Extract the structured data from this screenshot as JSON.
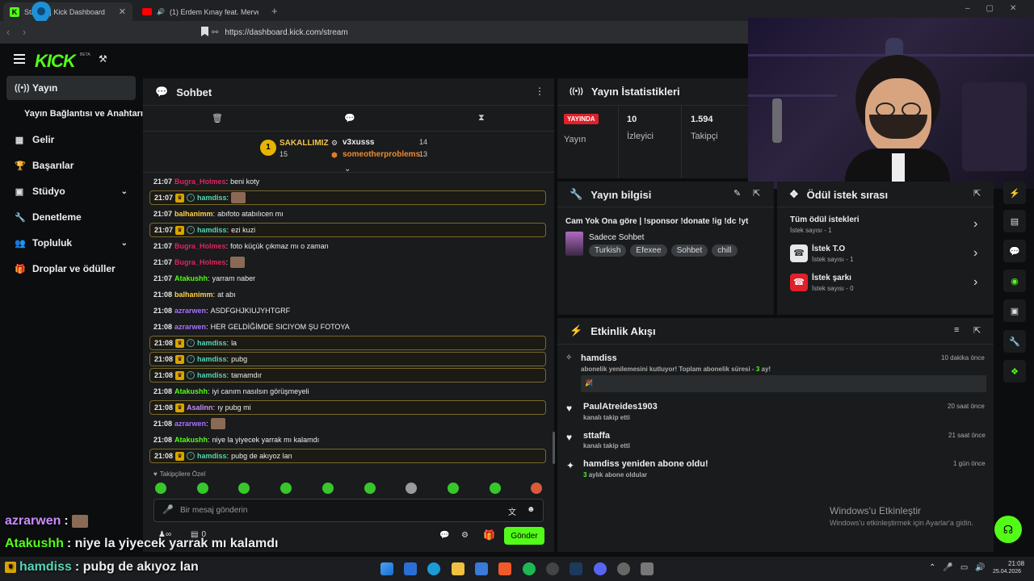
{
  "browser": {
    "tabs": [
      {
        "title": "Stream | Kick Dashboard",
        "active": true
      },
      {
        "title": "(1) Erdem Kınay feat. Merve Özbe...",
        "active": false
      }
    ],
    "url": "https://dashboard.kick.com/stream"
  },
  "app": {
    "logo": "KICK",
    "beta": "BETA"
  },
  "sidebar": {
    "items": [
      {
        "label": "Yayın",
        "icon": "broadcast-icon",
        "active": true
      },
      {
        "label": "Yayın Bağlantısı ve Anahtarı",
        "icon": ""
      },
      {
        "label": "Gelir",
        "icon": "money-icon"
      },
      {
        "label": "Başarılar",
        "icon": "trophy-icon"
      },
      {
        "label": "Stüdyo",
        "icon": "studio-icon",
        "chevron": true
      },
      {
        "label": "Denetleme",
        "icon": "wrench-icon"
      },
      {
        "label": "Topluluk",
        "icon": "community-icon",
        "chevron": true
      },
      {
        "label": "Droplar ve ödüller",
        "icon": "gift-icon"
      }
    ]
  },
  "chat": {
    "title": "Sohbet",
    "leaderboard": {
      "top": {
        "name": "SAKALLIMIZ",
        "count": "15",
        "rank": "1"
      },
      "others": [
        {
          "name": "v3xusss",
          "count": "14"
        },
        {
          "name": "someotherproblems",
          "count": "13"
        }
      ]
    },
    "messages": [
      {
        "time": "21:07",
        "user": "Bugra_Holmes",
        "color": "#e0245e",
        "text": "beni koty",
        "hl": false,
        "badges": false,
        "emote": false
      },
      {
        "time": "21:07",
        "user": "hamdiss",
        "color": "#53d6b7",
        "text": "",
        "hl": true,
        "badges": true,
        "emote": true
      },
      {
        "time": "21:07",
        "user": "balhanimm",
        "color": "#ffd24a",
        "text": "abıfoto atabılıcen mı",
        "hl": false,
        "badges": false,
        "emote": false
      },
      {
        "time": "21:07",
        "user": "hamdiss",
        "color": "#53d6b7",
        "text": "ezi kuzi",
        "hl": true,
        "badges": true,
        "emote": false
      },
      {
        "time": "21:07",
        "user": "Bugra_Holmes",
        "color": "#e0245e",
        "text": "foto küçük çıkmaz mı o zaman",
        "hl": false,
        "badges": false,
        "emote": false
      },
      {
        "time": "21:07",
        "user": "Bugra_Holmes",
        "color": "#e0245e",
        "text": "",
        "hl": false,
        "badges": false,
        "emote": true
      },
      {
        "time": "21:07",
        "user": "Atakushh",
        "color": "#53fc18",
        "text": "yarram naber",
        "hl": false,
        "badges": false,
        "emote": false
      },
      {
        "time": "21:08",
        "user": "balhanimm",
        "color": "#ffd24a",
        "text": "at abı",
        "hl": false,
        "badges": false,
        "emote": false
      },
      {
        "time": "21:08",
        "user": "azrarwen",
        "color": "#a970ff",
        "text": "ASDFGHJKIUJYHTGRF",
        "hl": false,
        "badges": false,
        "emote": false
      },
      {
        "time": "21:08",
        "user": "azrarwen",
        "color": "#a970ff",
        "text": "HER GELDİĞİMDE SICIYOM ŞU FOTOYA",
        "hl": false,
        "badges": false,
        "emote": false
      },
      {
        "time": "21:08",
        "user": "hamdiss",
        "color": "#53d6b7",
        "text": "la",
        "hl": true,
        "badges": true,
        "emote": false
      },
      {
        "time": "21:08",
        "user": "hamdiss",
        "color": "#53d6b7",
        "text": "pubg",
        "hl": true,
        "badges": true,
        "emote": false
      },
      {
        "time": "21:08",
        "user": "hamdiss",
        "color": "#53d6b7",
        "text": "tamamdır",
        "hl": true,
        "badges": true,
        "emote": false
      },
      {
        "time": "21:08",
        "user": "Atakushh",
        "color": "#53fc18",
        "text": "iyi canım nasılsın görüşmeyeli",
        "hl": false,
        "badges": false,
        "emote": false
      },
      {
        "time": "21:08",
        "user": "Asalinn",
        "color": "#c98cff",
        "text": "ıy pubg mi",
        "hl": true,
        "badges": true,
        "emote": false
      },
      {
        "time": "21:08",
        "user": "azrarwen",
        "color": "#a970ff",
        "text": "",
        "hl": false,
        "badges": false,
        "emote": true
      },
      {
        "time": "21:08",
        "user": "Atakushh",
        "color": "#53fc18",
        "text": "niye la yiyecek yarrak mı kalamdı",
        "hl": false,
        "badges": false,
        "emote": false
      },
      {
        "time": "21:08",
        "user": "hamdiss",
        "color": "#53d6b7",
        "text": "pubg de akıyoz lan",
        "hl": true,
        "badges": true,
        "emote": false
      }
    ],
    "followers_only": "Takipçilere Özel",
    "input_placeholder": "Bir mesaj gönderin",
    "send_label": "Gönder",
    "viewer_count": "0"
  },
  "stats": {
    "title": "Yayın İstatistikleri",
    "live_badge": "YAYINDA",
    "live_label": "Yayın",
    "viewers": {
      "value": "10",
      "label": "İzleyici"
    },
    "followers": {
      "value": "1.594",
      "label": "Takipçi"
    }
  },
  "stream_info": {
    "title": "Yayın bilgisi",
    "stream_title": "Cam Yok Ona göre | !sponsor !donate !ig !dc !yt",
    "category": "Sadece Sohbet",
    "tags": [
      "Turkish",
      "Efexee",
      "Sohbet",
      "chill"
    ]
  },
  "rewards": {
    "title": "Ödül istek sırası",
    "all": {
      "label": "Tüm ödül istekleri",
      "sub": "İstek sayısı - 1"
    },
    "items": [
      {
        "label": "İstek T.O",
        "sub": "İstek sayısı - 1"
      },
      {
        "label": "İstek şarkı",
        "sub": "İstek sayısı - 0"
      }
    ]
  },
  "activity": {
    "title": "Etkinlik Akışı",
    "items": [
      {
        "name": "hamdiss",
        "sub_pre": "abonelik yenilemesini kutluyor! Toplam abonelik süresi -",
        "sub_num": "3",
        "sub_post": "ay!",
        "time": "10 dakika önce"
      },
      {
        "name": "PaulAtreides1903",
        "sub": "kanalı takip etti",
        "time": "20 saat önce"
      },
      {
        "name": "sttaffa",
        "sub": "kanalı takip etti",
        "time": "21 saat önce"
      },
      {
        "name": "hamdiss yeniden abone oldu!",
        "sub_num": "3",
        "sub_post": "aylık abone oldular",
        "time": "1 gün önce"
      }
    ]
  },
  "windows_watermark": {
    "title": "Windows'u Etkinleştir",
    "sub": "Windows'u etkinleştirmek için Ayarlar'a gidin."
  },
  "overlay": [
    {
      "user": "azrarwen",
      "text": ":",
      "color": "#c98cff"
    },
    {
      "user": "Atakushh",
      "text": ": niye la yiyecek yarrak mı kalamdı",
      "color": "#53fc18"
    },
    {
      "user": "hamdiss",
      "text": ": pubg de akıyoz lan",
      "color": "#53d6b7"
    }
  ],
  "taskbar": {
    "time": "21:08",
    "date": "25.04.2026"
  }
}
